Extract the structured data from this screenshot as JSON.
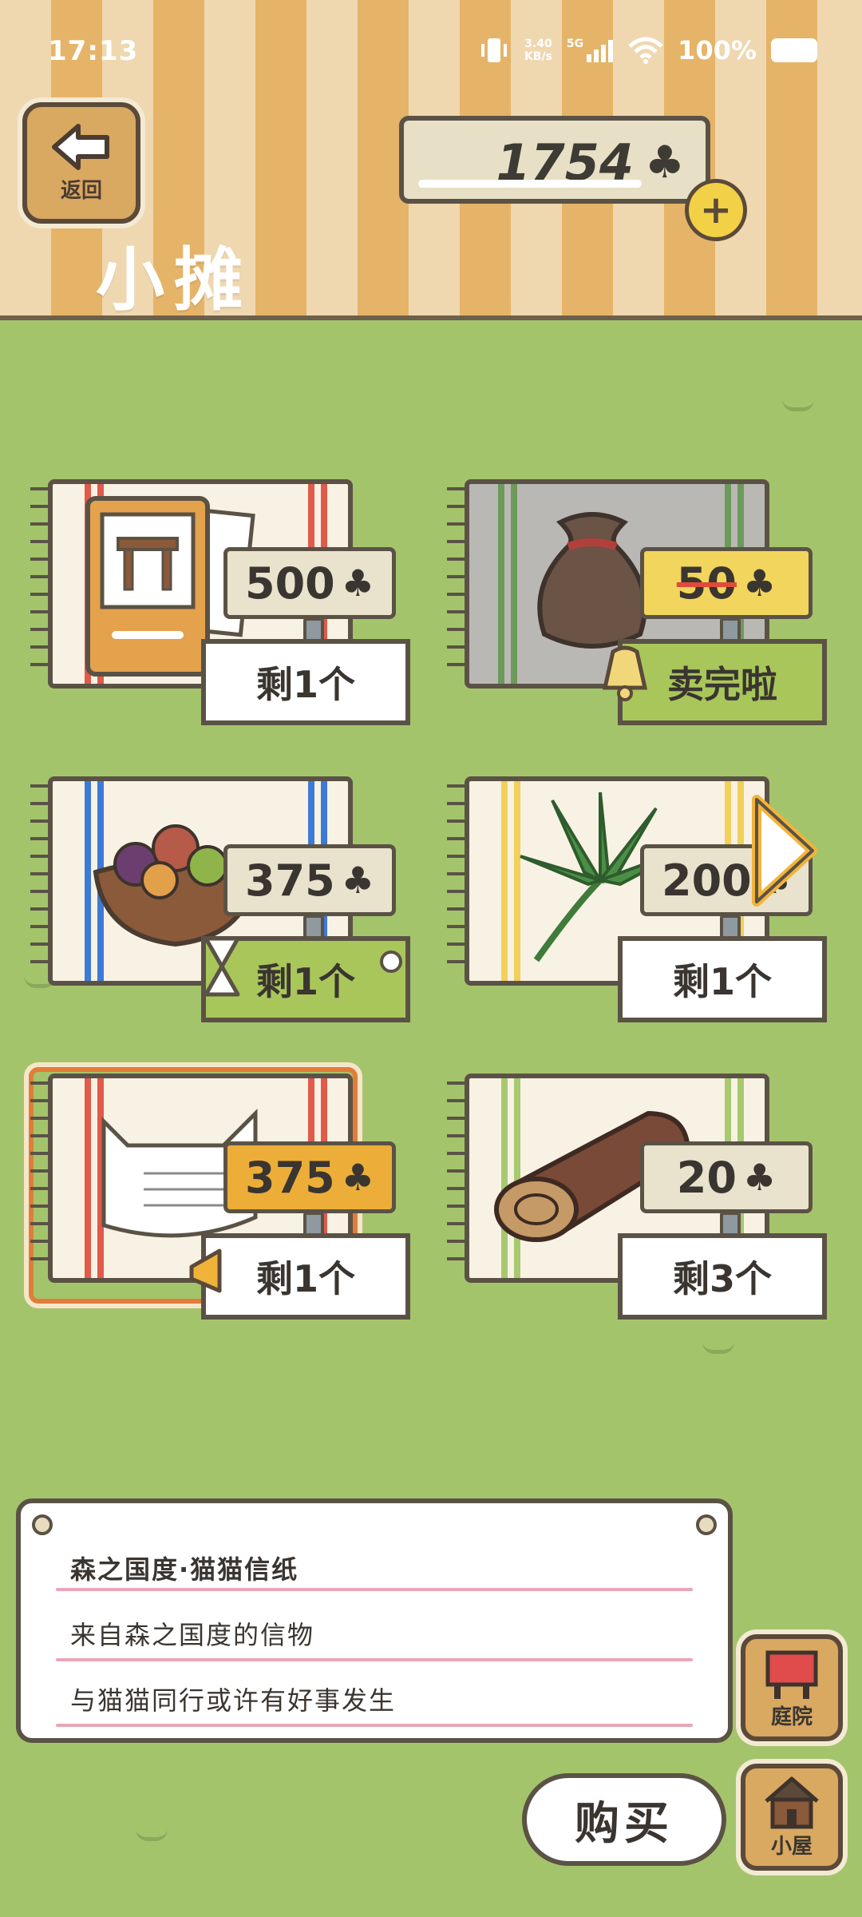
{
  "status_bar": {
    "time": "17:13",
    "net_speed_value": "3.40",
    "net_speed_unit": "KB/s",
    "network": "5G",
    "battery": "100%"
  },
  "header": {
    "back_label": "返回",
    "coins": "1754",
    "title": "小摊"
  },
  "items": [
    {
      "price": "500",
      "stock": "剩1个",
      "state": "normal",
      "icon": "stool-card-icon"
    },
    {
      "price": "50",
      "stock": "卖完啦",
      "state": "sold-out",
      "icon": "sack-icon"
    },
    {
      "price": "375",
      "stock": "剩1个",
      "state": "timed",
      "icon": "vegetable-bowl-icon"
    },
    {
      "price": "200",
      "stock": "剩1个",
      "state": "normal",
      "icon": "palm-leaf-icon"
    },
    {
      "price": "375",
      "stock": "剩1个",
      "state": "selected",
      "icon": "cat-letter-paper-icon"
    },
    {
      "price": "20",
      "stock": "剩3个",
      "state": "normal",
      "icon": "log-icon"
    }
  ],
  "description": {
    "name": "森之国度·猫猫信纸",
    "line1": "来自森之国度的信物",
    "line2": "与猫猫同行或许有好事发生"
  },
  "buttons": {
    "buy": "购买",
    "yard": "庭院",
    "house": "小屋"
  },
  "colors": {
    "grass": "#a4c46c",
    "stripe_light": "#efd7b0",
    "stripe_dark": "#e5b468",
    "selected_outline": "#e07d3a"
  }
}
